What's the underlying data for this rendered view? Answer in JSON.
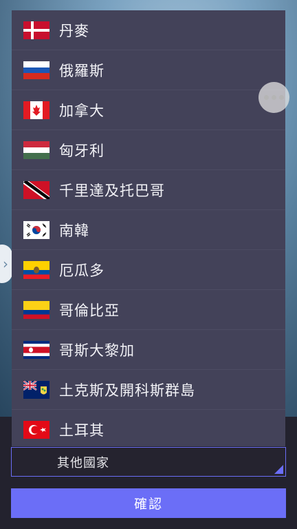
{
  "countries": [
    {
      "name": "丹麥",
      "flag": "denmark-flag-icon"
    },
    {
      "name": "俄羅斯",
      "flag": "russia-flag-icon"
    },
    {
      "name": "加拿大",
      "flag": "canada-flag-icon"
    },
    {
      "name": "匈牙利",
      "flag": "hungary-flag-icon"
    },
    {
      "name": "千里達及托巴哥",
      "flag": "trinidad-tobago-flag-icon"
    },
    {
      "name": "南韓",
      "flag": "south-korea-flag-icon"
    },
    {
      "name": "厄瓜多",
      "flag": "ecuador-flag-icon"
    },
    {
      "name": "哥倫比亞",
      "flag": "colombia-flag-icon"
    },
    {
      "name": "哥斯大黎加",
      "flag": "costa-rica-flag-icon"
    },
    {
      "name": "土克斯及開科斯群島",
      "flag": "turks-caicos-flag-icon"
    },
    {
      "name": "土耳其",
      "flag": "turkey-flag-icon"
    }
  ],
  "select": {
    "value": "其他國家"
  },
  "confirm": {
    "label": "確認"
  },
  "colors": {
    "accent": "#6b6ef7",
    "list_bg": "#434259"
  }
}
